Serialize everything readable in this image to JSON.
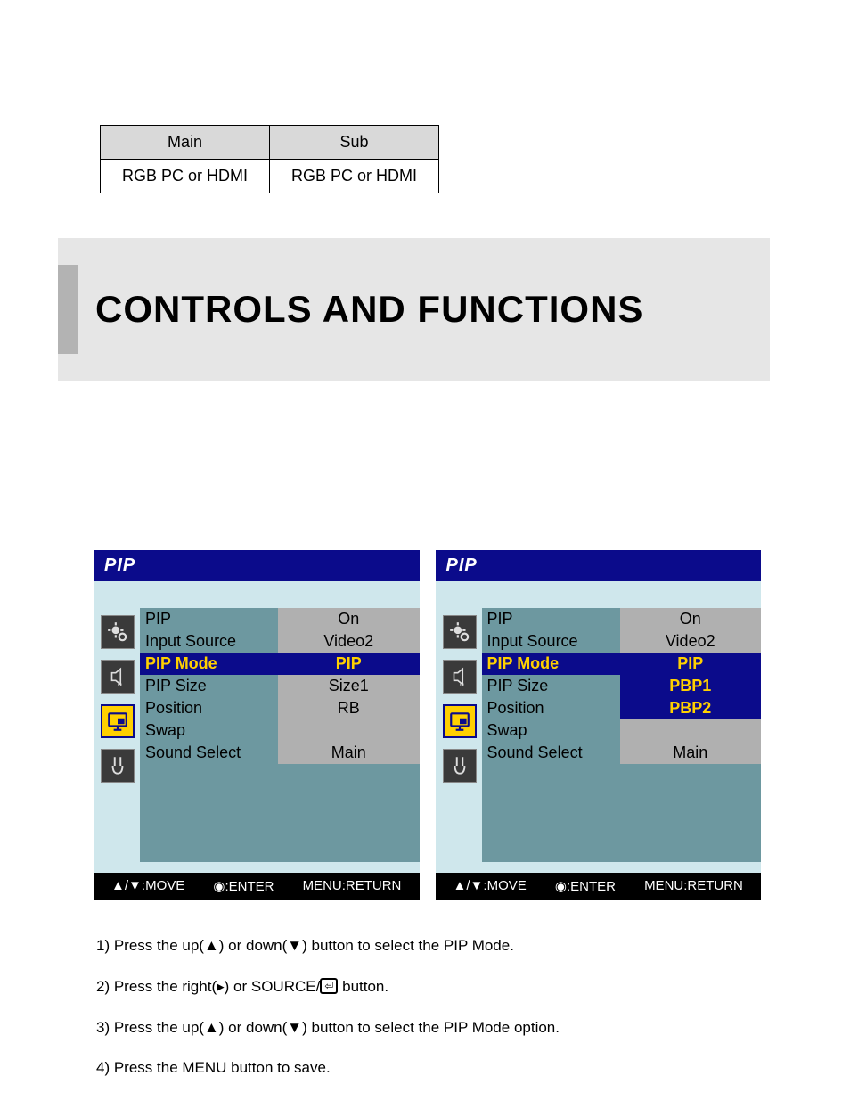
{
  "table": {
    "head": [
      "Main",
      "Sub"
    ],
    "row": [
      "RGB PC or HDMI",
      "RGB PC or HDMI"
    ]
  },
  "heading": "CONTROLS AND FUNCTIONS",
  "osd_left": {
    "title": "PIP",
    "rows": [
      {
        "label": "PIP",
        "value": "On",
        "sel": false
      },
      {
        "label": "Input Source",
        "value": "Video2",
        "sel": false
      },
      {
        "label": "PIP Mode",
        "value": "PIP",
        "sel": true
      },
      {
        "label": "PIP Size",
        "value": "Size1",
        "sel": false
      },
      {
        "label": "Position",
        "value": "RB",
        "sel": false
      },
      {
        "label": "Swap",
        "value": "",
        "sel": false
      },
      {
        "label": "Sound Select",
        "value": "Main",
        "sel": false
      }
    ],
    "footer": {
      "move": "▲/▼:MOVE",
      "enter": "◉:ENTER",
      "ret": "MENU:RETURN"
    }
  },
  "osd_right": {
    "title": "PIP",
    "rows": [
      {
        "label": "PIP",
        "value": "On",
        "style": ""
      },
      {
        "label": "Input Source",
        "value": "Video2",
        "style": ""
      },
      {
        "label": "PIP Mode",
        "value": "PIP",
        "style": "sel"
      },
      {
        "label": "PIP Size",
        "value": "PBP1",
        "style": "sub"
      },
      {
        "label": "Position",
        "value": "PBP2",
        "style": "sub"
      },
      {
        "label": "Swap",
        "value": "",
        "style": ""
      },
      {
        "label": "Sound Select",
        "value": "Main",
        "style": ""
      }
    ],
    "footer": {
      "move": "▲/▼:MOVE",
      "enter": "◉:ENTER",
      "ret": "MENU:RETURN"
    }
  },
  "sidebar_icons": [
    "brightness",
    "audio",
    "pip",
    "setup"
  ],
  "instructions": {
    "s1a": "1) Press the up(▲) or down(▼) button to select the PIP Mode.",
    "s2a": "2) Press the right(▸) or SOURCE/",
    "s2b": "  button.",
    "s3": "3) Press the up(▲) or down(▼) button to select the PIP Mode option.",
    "s4": "4) Press the MENU button to save."
  },
  "enter_glyph": "⏎"
}
